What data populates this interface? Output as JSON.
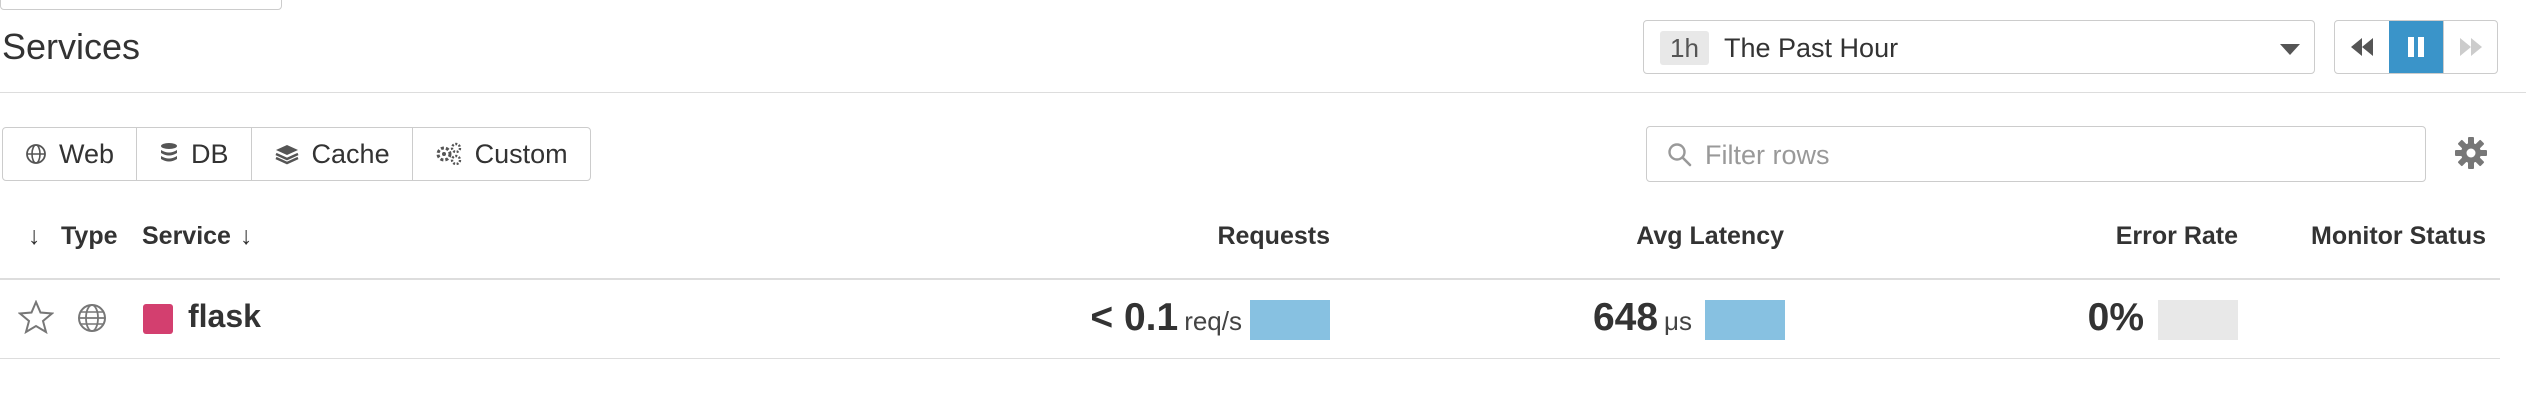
{
  "page": {
    "title": "Services"
  },
  "timepicker": {
    "badge": "1h",
    "label": "The Past Hour"
  },
  "filters": [
    {
      "label": "Web",
      "icon": "globe-icon"
    },
    {
      "label": "DB",
      "icon": "database-icon"
    },
    {
      "label": "Cache",
      "icon": "layers-icon"
    },
    {
      "label": "Custom",
      "icon": "gears-icon"
    }
  ],
  "filter_rows": {
    "placeholder": "Filter rows"
  },
  "table": {
    "headers": {
      "sort_type": "↓",
      "type": "Type",
      "service": "Service",
      "service_sort": "↓",
      "requests": "Requests",
      "avg_latency": "Avg Latency",
      "error_rate": "Error Rate",
      "monitor_status": "Monitor Status"
    },
    "rows": [
      {
        "service": "flask",
        "service_color": "#d33f6f",
        "type_icon": "globe-icon",
        "requests_value": "< 0.1",
        "requests_unit": "req/s",
        "latency_value": "648",
        "latency_unit": "μs",
        "error_rate": "0%"
      }
    ]
  },
  "colors": {
    "accent": "#3a94c9",
    "bar": "#87c1e1",
    "bar_empty": "#e8e8e8"
  }
}
